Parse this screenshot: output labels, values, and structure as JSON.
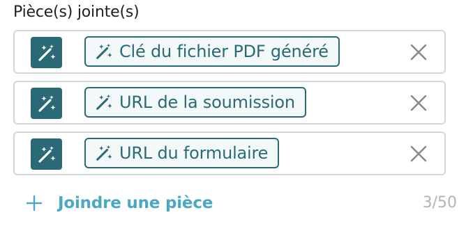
{
  "section": {
    "label": "Pièce(s) jointe(s)"
  },
  "attachments": [
    {
      "label": "Clé du fichier PDF généré",
      "icon": "magic-wand-icon"
    },
    {
      "label": "URL de la soumission",
      "icon": "magic-wand-icon"
    },
    {
      "label": "URL du formulaire",
      "icon": "magic-wand-icon"
    }
  ],
  "icons": {
    "remove": "close-icon",
    "add": "plus-icon"
  },
  "footer": {
    "add_label": "Joindre une pièce",
    "counter": "3/50"
  },
  "colors": {
    "accent": "#2a6a76",
    "token_bg": "#f3f8f8",
    "link": "#4aa9c2",
    "border": "#d4d7da",
    "muted": "#b3b3b3"
  }
}
